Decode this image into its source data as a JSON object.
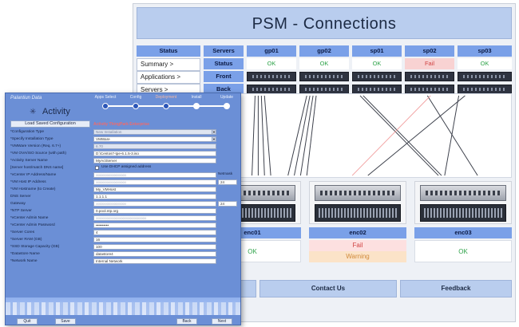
{
  "psm": {
    "title": "PSM - Connections",
    "nav_header": "Status",
    "nav": [
      "Summary >",
      "Applications >",
      "Servers >"
    ],
    "servers_header": "Servers",
    "row_labels": {
      "status": "Status",
      "front": "Front",
      "back": "Back"
    },
    "servers": [
      {
        "name": "gp01",
        "status": "OK"
      },
      {
        "name": "gp02",
        "status": "OK"
      },
      {
        "name": "sp01",
        "status": "OK"
      },
      {
        "name": "sp02",
        "status": "Fail"
      },
      {
        "name": "sp03",
        "status": "OK"
      }
    ],
    "enclosures": [
      {
        "name": "enc01",
        "status": "OK",
        "warning": ""
      },
      {
        "name": "enc02",
        "status": "Fail",
        "warning": "Warning"
      },
      {
        "name": "enc03",
        "status": "OK",
        "warning": ""
      }
    ],
    "footer": {
      "contact": "Contact Us",
      "feedback": "Feedback"
    },
    "colors": {
      "ok": "#2fa34a",
      "fail": "#d04343",
      "header": "#7aa0e8",
      "fail_link": "#f2a3a3"
    }
  },
  "wizard": {
    "window_title": "Palantiun Data",
    "logo_text": "Activity",
    "steps": [
      {
        "label": "Apps Select",
        "state": "done"
      },
      {
        "label": "Config",
        "state": "done"
      },
      {
        "label": "Deployment",
        "state": "current"
      },
      {
        "label": "Install",
        "state": "todo"
      },
      {
        "label": "Update",
        "state": "todo"
      }
    ],
    "load_button": "Load Saved Configuration",
    "edition": "Activity ThingPark Enterprise",
    "fields": [
      {
        "label": "*Configuration Type",
        "value": "New Installation",
        "style": "dis",
        "dropdown": true
      },
      {
        "label": "*Specify Installation Type",
        "value": "VMWare",
        "style": "",
        "dropdown": true
      },
      {
        "label": "*VMWare Version (Req. 6.7+)",
        "value": "6.70",
        "style": "dis",
        "dropdown": false
      },
      {
        "label": "*VM OVA/ISO Source (with path)",
        "value": "D:\\Centos7-tpe-6.1.5-3.iso",
        "style": "",
        "dropdown": false
      },
      {
        "label": "*Activity Server Name",
        "value": "MyActServer",
        "style": "",
        "dropdown": false
      },
      {
        "label": "[Server host/match DNS name]",
        "value": "",
        "style": "none",
        "dropdown": false
      },
      {
        "label": "*vCenter IP Address/Name",
        "value": "xxxxxxxxxxxxxxxxxxxxx",
        "style": "blur",
        "dropdown": false
      },
      {
        "label": "*VM Host IP Address",
        "value": "xxxxxxxxxxxxxxxxxxxxx",
        "style": "blur",
        "dropdown": false
      },
      {
        "label": "*VM Hostname (to Create)",
        "value": "My_VMHost",
        "style": "",
        "dropdown": false
      },
      {
        "label": "DNS Server",
        "value": "1.1.1.1",
        "style": "",
        "dropdown": false
      },
      {
        "label": "Gateway",
        "value": "xxxxxxxxxxxxxxxxxxxxx",
        "style": "blur",
        "dropdown": false
      },
      {
        "label": "*NTP Server",
        "value": "0.pool.ntp.org",
        "style": "",
        "dropdown": false
      },
      {
        "label": "*vCenter Admin Name",
        "value": "xxxxxxxxxxxxxxxxxxxxxxxxxxxxxxxxxxx",
        "style": "blur",
        "dropdown": false
      },
      {
        "label": "*vCenter Admin Password",
        "value": "••••••••••",
        "style": "",
        "dropdown": false
      },
      {
        "label": "*Server Cores",
        "value": "4",
        "style": "",
        "dropdown": false
      },
      {
        "label": "*Server RAM (GB)",
        "value": "16",
        "style": "",
        "dropdown": false
      },
      {
        "label": "*SSD Storage Capacity (GB)",
        "value": "100",
        "style": "",
        "dropdown": false
      },
      {
        "label": "*Datastore Name",
        "value": "datastore4",
        "style": "",
        "dropdown": false
      },
      {
        "label": "*Network Name",
        "value": "Internal Network",
        "style": "",
        "dropdown": false
      }
    ],
    "dhcp_label": "Use DHCP assigned address",
    "netmask_label": "Netmask",
    "netmask_value": "24",
    "gateway_side_value": "24",
    "buttons": {
      "quit": "Quit",
      "save": "Save",
      "back": "Back",
      "next": "Next"
    }
  }
}
